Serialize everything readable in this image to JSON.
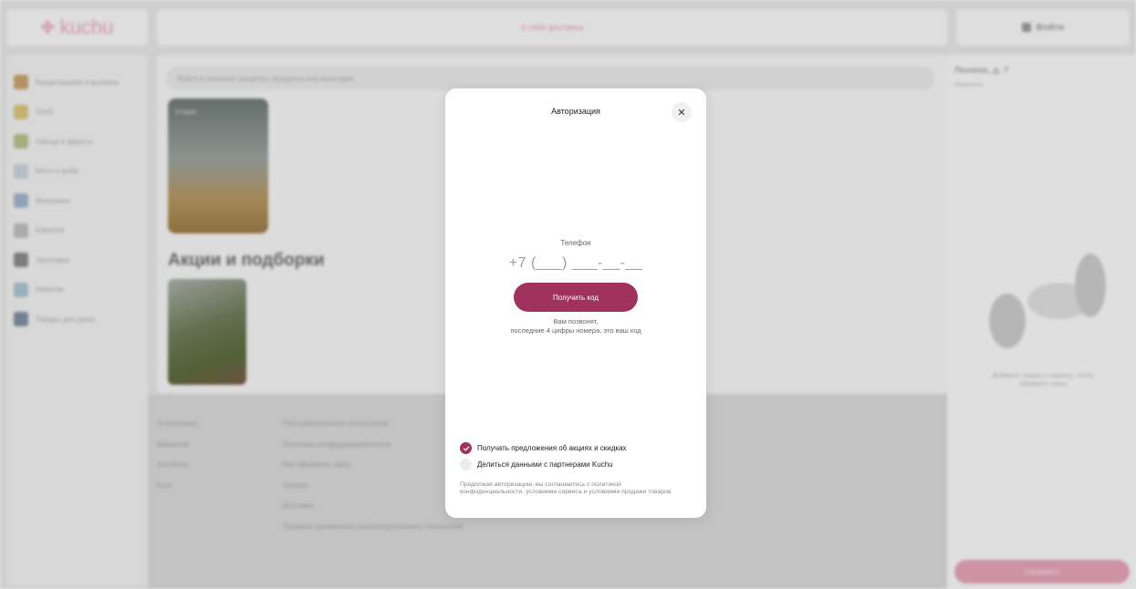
{
  "background": {
    "logo": "kuchu",
    "topbar_text": "К себе доставка",
    "login_label": "Войти",
    "sidebar_items": [
      {
        "label": "Кондитерская и выпечка",
        "color": "#c9a06a"
      },
      {
        "label": "Хлеб",
        "color": "#d7c47a"
      },
      {
        "label": "Овощи и фрукты",
        "color": "#b4bf8a"
      },
      {
        "label": "Мясо и рыба",
        "color": "#c8d0d8"
      },
      {
        "label": "Молочное",
        "color": "#9fb4c8"
      },
      {
        "label": "Бакалея",
        "color": "#bdbdbd"
      },
      {
        "label": "Заготовки",
        "color": "#8a8a8a"
      },
      {
        "label": "Напитки",
        "color": "#a9c2d0"
      },
      {
        "label": "Товары для дома",
        "color": "#7d8ea0"
      }
    ],
    "search_placeholder": "Найти в каталоге: рецепты, продукты или категории",
    "story_label": "Сторис",
    "promo_title": "Акции и подборки",
    "footer_col1": [
      "О компании",
      "Вакансии",
      "Контакты",
      "Блог"
    ],
    "footer_col2": [
      "Пользовательское соглашение",
      "Политика конфиденциальности",
      "Как оформить заказ",
      "Оплата",
      "Доставка",
      "Правила применения рекомендательных технологий"
    ],
    "address": "Ленина, д. 7",
    "address_sub": "Изменить",
    "right_caption": "Добавьте товары в корзину, чтобы оформить заказ",
    "checkout_label": "Оформить"
  },
  "modal": {
    "title": "Авторизация",
    "close_symbol": "✕",
    "phone_label": "Телефон",
    "phone_placeholder": "+7 (___) ___-__-__",
    "get_code_label": "Получить код",
    "hint_line1": "Вам позвонят,",
    "hint_line2": "последние 4 цифры номера, это ваш код",
    "checkbox_promo": {
      "label": "Получать предложения об акциях и скидках",
      "checked": true
    },
    "checkbox_share": {
      "label": "Делиться данными с партнерами Kuchu",
      "checked": false
    },
    "legal_text": "Продолжая авторизацию, вы соглашаетесь с политикой конфиденциальности, условиями сервиса и условиями продажи товаров",
    "accent_color": "#a0325d"
  }
}
